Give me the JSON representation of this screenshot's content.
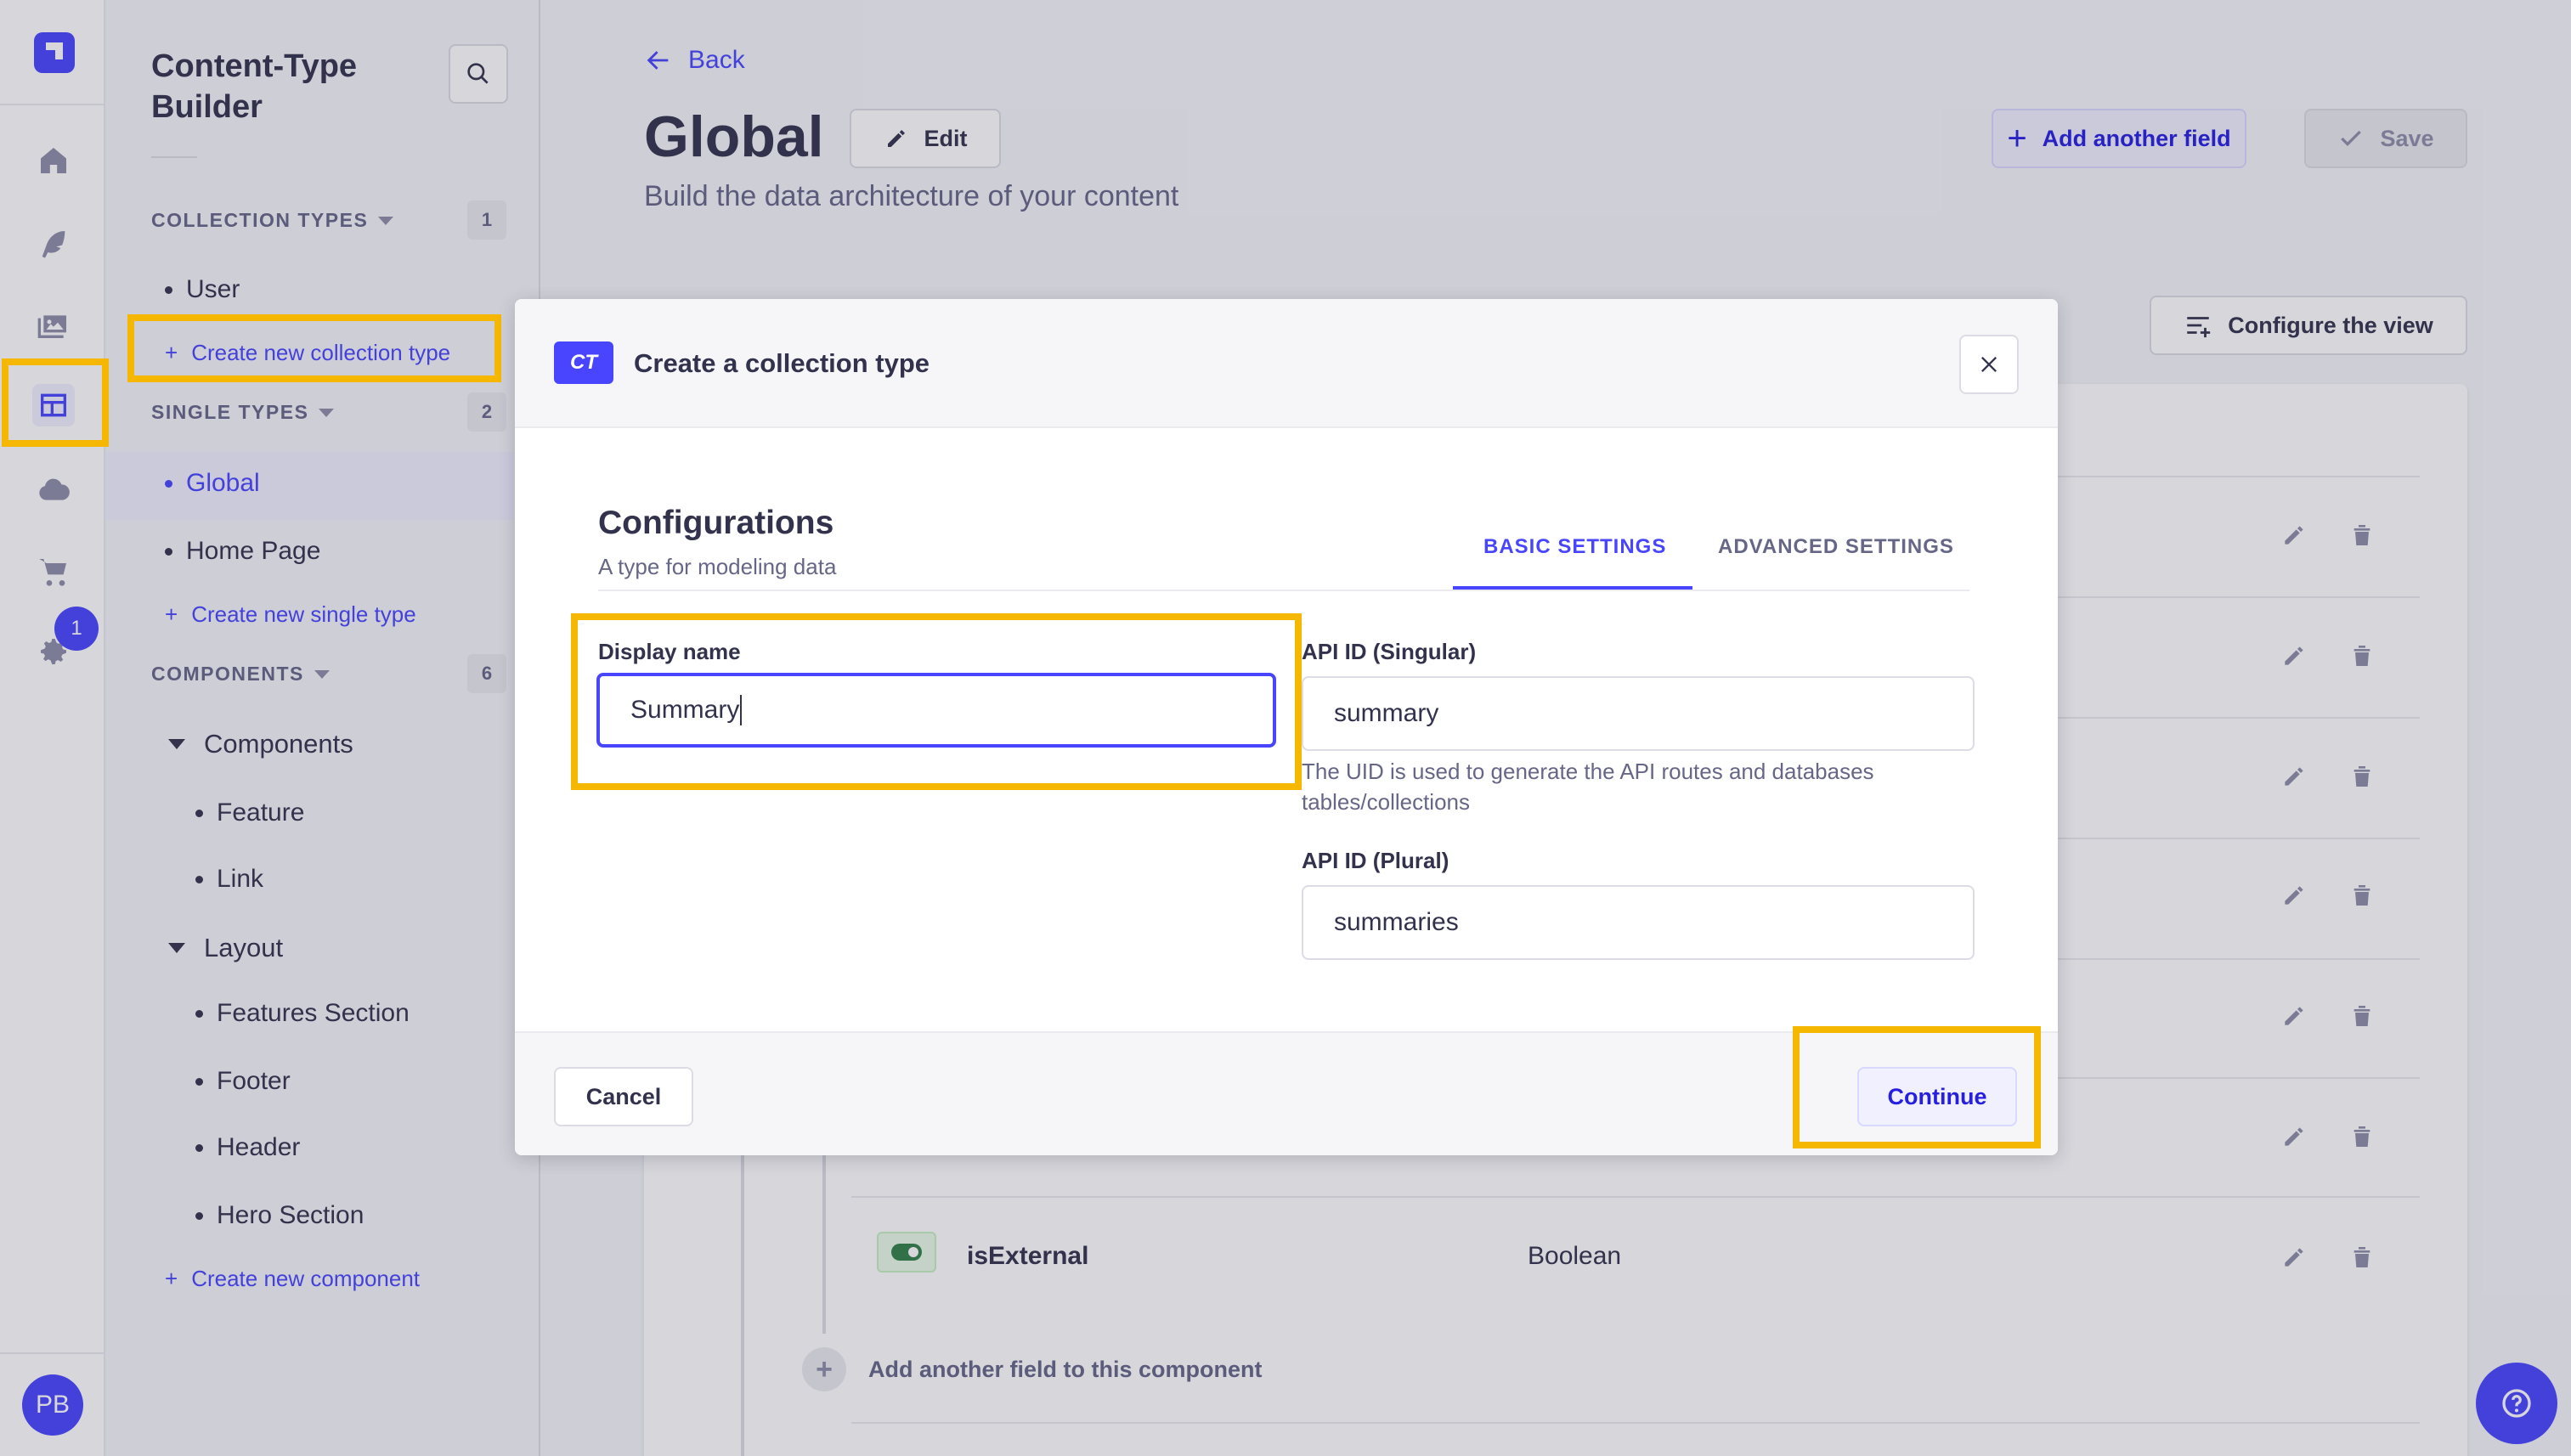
{
  "rail": {
    "icons": [
      "logo-icon",
      "home-icon",
      "content-manager-icon",
      "media-library-icon",
      "content-type-builder-icon",
      "cloud-icon",
      "cart-icon",
      "settings-icon"
    ],
    "settings_badge": "1",
    "avatar": "PB"
  },
  "subnav": {
    "title": "Content-Type Builder",
    "collection_types": {
      "label": "COLLECTION TYPES",
      "count": "1",
      "items": [
        "User"
      ],
      "create": "Create new collection type"
    },
    "single_types": {
      "label": "SINGLE TYPES",
      "count": "2",
      "items": [
        "Global",
        "Home Page"
      ],
      "create": "Create new single type"
    },
    "components": {
      "label": "COMPONENTS",
      "count": "6",
      "groups": [
        {
          "name": "Components",
          "items": [
            "Feature",
            "Link"
          ]
        },
        {
          "name": "Layout",
          "items": [
            "Features Section",
            "Footer",
            "Header",
            "Hero Section"
          ]
        }
      ],
      "create": "Create new component"
    }
  },
  "header": {
    "back": "Back",
    "title": "Global",
    "edit": "Edit",
    "subtitle": "Build the data architecture of your content",
    "add_field": "Add another field",
    "save": "Save",
    "configure_view": "Configure the view"
  },
  "table": {
    "visible_field": {
      "name": "isExternal",
      "type": "Boolean"
    },
    "add_component_field": "Add another field to this component"
  },
  "modal": {
    "badge": "CT",
    "title": "Create a collection type",
    "section_title": "Configurations",
    "section_subtitle": "A type for modeling data",
    "tabs": [
      "BASIC SETTINGS",
      "ADVANCED SETTINGS"
    ],
    "display_name": {
      "label": "Display name",
      "value": "Summary"
    },
    "api_singular": {
      "label": "API ID (Singular)",
      "value": "summary",
      "hint": "The UID is used to generate the API routes and databases tables/collections"
    },
    "api_plural": {
      "label": "API ID (Plural)",
      "value": "summaries"
    },
    "cancel": "Cancel",
    "continue": "Continue"
  },
  "colors": {
    "primary": "#4945ff",
    "highlight": "#f5b700",
    "text": "#32324d",
    "muted": "#666687"
  }
}
